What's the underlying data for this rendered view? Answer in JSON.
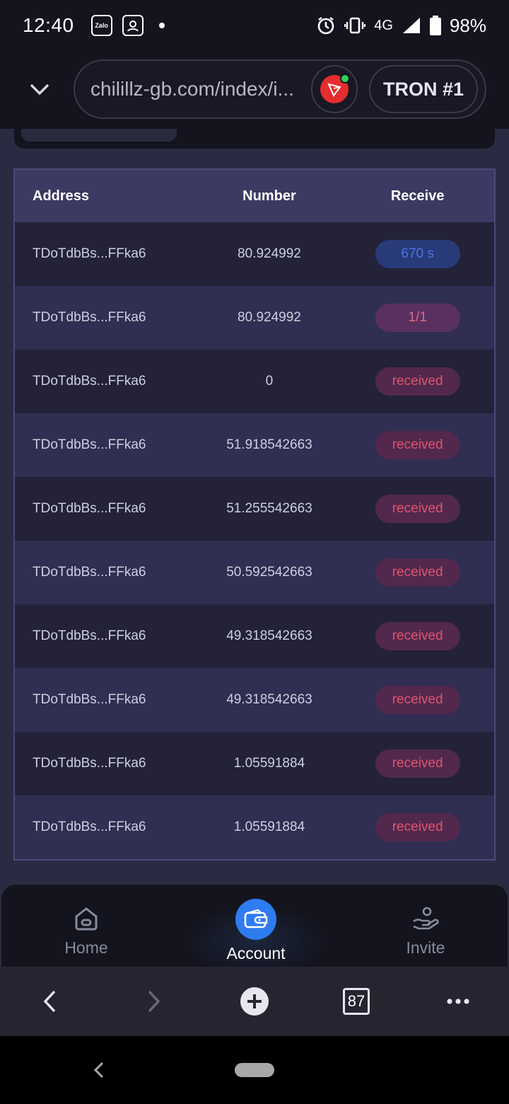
{
  "status_bar": {
    "time": "12:40",
    "app_icons": [
      "Zalo",
      "avatar"
    ],
    "network": "4G",
    "battery": "98%"
  },
  "browser": {
    "url": "chilillz-gb.com/index/i...",
    "wallet_label": "TRON #1",
    "tabs_count": "87"
  },
  "table": {
    "headers": {
      "address": "Address",
      "number": "Number",
      "receive": "Receive"
    },
    "rows": [
      {
        "address": "TDoTdbBs...FFka6",
        "number": "80.924992",
        "receive": "670 s",
        "type": "timer"
      },
      {
        "address": "TDoTdbBs...FFka6",
        "number": "80.924992",
        "receive": "1/1",
        "type": "ratio"
      },
      {
        "address": "TDoTdbBs...FFka6",
        "number": "0",
        "receive": "received",
        "type": "received"
      },
      {
        "address": "TDoTdbBs...FFka6",
        "number": "51.918542663",
        "receive": "received",
        "type": "received"
      },
      {
        "address": "TDoTdbBs...FFka6",
        "number": "51.255542663",
        "receive": "received",
        "type": "received"
      },
      {
        "address": "TDoTdbBs...FFka6",
        "number": "50.592542663",
        "receive": "received",
        "type": "received"
      },
      {
        "address": "TDoTdbBs...FFka6",
        "number": "49.318542663",
        "receive": "received",
        "type": "received"
      },
      {
        "address": "TDoTdbBs...FFka6",
        "number": "49.318542663",
        "receive": "received",
        "type": "received"
      },
      {
        "address": "TDoTdbBs...FFka6",
        "number": "1.05591884",
        "receive": "received",
        "type": "received"
      },
      {
        "address": "TDoTdbBs...FFka6",
        "number": "1.05591884",
        "receive": "received",
        "type": "received"
      }
    ]
  },
  "app_nav": {
    "home": "Home",
    "account": "Account",
    "invite": "Invite",
    "active": "account"
  },
  "colors": {
    "accent": "#2f7bf0",
    "received": "#e0546e",
    "timer": "#4e73e8"
  }
}
